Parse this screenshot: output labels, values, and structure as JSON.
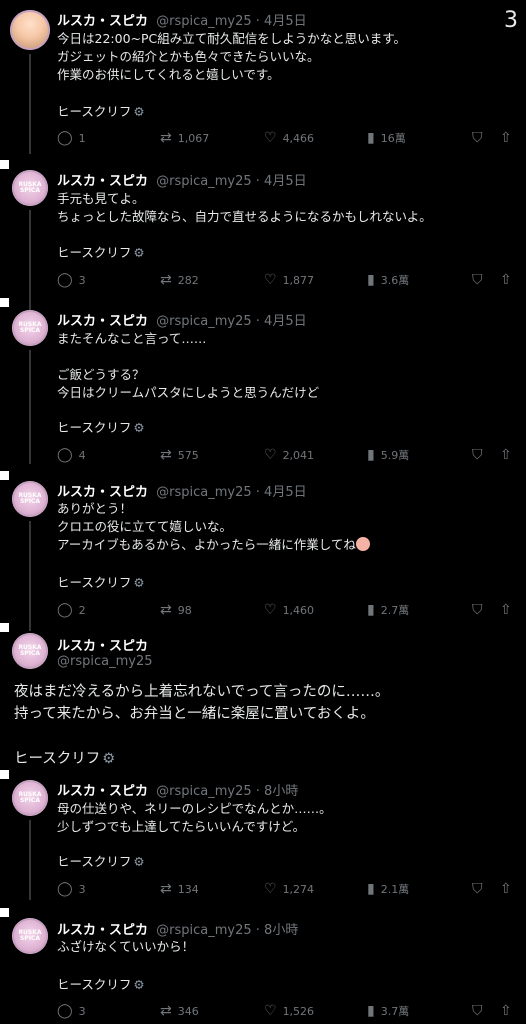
{
  "corner_number": "3",
  "tweets": [
    {
      "name": "ルスカ・スピカ",
      "handle": "@rspica_my25 · 4月5日",
      "lines": [
        "今日は22:00~PC組み立て耐久配信をしようかなと思います。",
        "ガジェットの紹介とかも色々できたらいいな。",
        "作業のお供にしてくれると嬉しいです。"
      ],
      "sig": "ヒースクリフ",
      "replies": "1",
      "retweets": "1,067",
      "likes": "4,466",
      "views": "16萬"
    },
    {
      "name": "ルスカ・スピカ",
      "handle": "@rspica_my25 · 4月5日",
      "lines": [
        "手元も見てよ。",
        "ちょっとした故障なら、自力で直せるようになるかもしれないよ。"
      ],
      "sig": "ヒースクリフ",
      "replies": "3",
      "retweets": "282",
      "likes": "1,877",
      "views": "3.6萬"
    },
    {
      "name": "ルスカ・スピカ",
      "handle": "@rspica_my25 · 4月5日",
      "lines": [
        "またそんなこと言って……",
        "",
        "ご飯どうする？",
        "今日はクリームパスタにしようと思うんだけど"
      ],
      "sig": "ヒースクリフ",
      "replies": "4",
      "retweets": "575",
      "likes": "2,041",
      "views": "5.9萬"
    },
    {
      "name": "ルスカ・スピカ",
      "handle": "@rspica_my25 · 4月5日",
      "lines": [
        "ありがとう！",
        "クロエの役に立てて嬉しいな。",
        "アーカイブもあるから、よかったら一緒に作業してね"
      ],
      "sig": "ヒースクリフ",
      "replies": "2",
      "retweets": "98",
      "likes": "1,460",
      "views": "2.7萬"
    }
  ],
  "main_tweet": {
    "name": "ルスカ・スピカ",
    "handle": "@rspica_my25",
    "lines": [
      "夜はまだ冷えるから上着忘れないでって言ったのに……。",
      "持って来たから、お弁当と一緒に楽屋に置いておくよ。"
    ],
    "sig": "ヒースクリフ"
  },
  "replies": [
    {
      "name": "ルスカ・スピカ",
      "handle": "@rspica_my25 · 8小時",
      "lines": [
        "母の仕送りや、ネリーのレシピでなんとか……。",
        "少しずつでも上達してたらいいんですけど。"
      ],
      "sig": "ヒースクリフ",
      "replies": "3",
      "retweets": "134",
      "likes": "1,274",
      "views": "2.1萬"
    },
    {
      "name": "ルスカ・スピカ",
      "handle": "@rspica_my25 · 8小時",
      "lines": [
        "ふざけなくていいから！"
      ],
      "sig": "ヒースクリフ",
      "replies": "3",
      "retweets": "346",
      "likes": "1,526",
      "views": "3.7萬"
    }
  ]
}
